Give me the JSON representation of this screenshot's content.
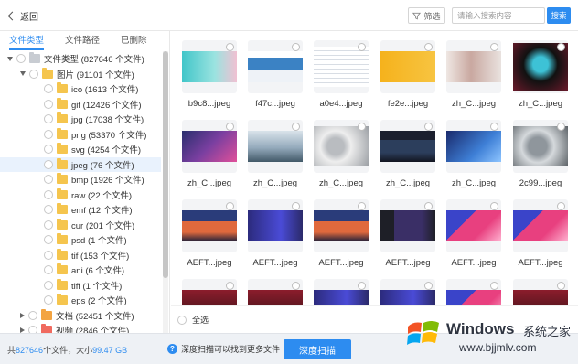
{
  "header": {
    "back_label": "返回",
    "filter_label": "筛选",
    "search_placeholder": "请输入搜索内容",
    "search_button": "搜索"
  },
  "sidebar": {
    "tabs": [
      {
        "label": "文件类型",
        "active": true
      },
      {
        "label": "文件路径",
        "active": false
      },
      {
        "label": "已删除",
        "active": false
      }
    ],
    "tree": [
      {
        "label": "文件类型 (827646 个文件)",
        "level": 0,
        "toggle": "down",
        "icon": "folder-gray"
      },
      {
        "label": "图片 (91101 个文件)",
        "level": 1,
        "toggle": "down",
        "icon": "folder-yellow"
      },
      {
        "label": "ico (1613 个文件)",
        "level": 2,
        "toggle": "",
        "icon": "folder-yellow"
      },
      {
        "label": "gif (12426 个文件)",
        "level": 2,
        "toggle": "",
        "icon": "folder-yellow"
      },
      {
        "label": "jpg (17038 个文件)",
        "level": 2,
        "toggle": "",
        "icon": "folder-yellow"
      },
      {
        "label": "png (53370 个文件)",
        "level": 2,
        "toggle": "",
        "icon": "folder-yellow"
      },
      {
        "label": "svg (4254 个文件)",
        "level": 2,
        "toggle": "",
        "icon": "folder-yellow"
      },
      {
        "label": "jpeg (76 个文件)",
        "level": 2,
        "toggle": "",
        "icon": "folder-yellow",
        "selected": true
      },
      {
        "label": "bmp (1926 个文件)",
        "level": 2,
        "toggle": "",
        "icon": "folder-yellow"
      },
      {
        "label": "raw (22 个文件)",
        "level": 2,
        "toggle": "",
        "icon": "folder-yellow"
      },
      {
        "label": "emf (12 个文件)",
        "level": 2,
        "toggle": "",
        "icon": "folder-yellow"
      },
      {
        "label": "cur (201 个文件)",
        "level": 2,
        "toggle": "",
        "icon": "folder-yellow"
      },
      {
        "label": "psd (1 个文件)",
        "level": 2,
        "toggle": "",
        "icon": "folder-yellow"
      },
      {
        "label": "tif (153 个文件)",
        "level": 2,
        "toggle": "",
        "icon": "folder-yellow"
      },
      {
        "label": "ani (6 个文件)",
        "level": 2,
        "toggle": "",
        "icon": "folder-yellow"
      },
      {
        "label": "tiff (1 个文件)",
        "level": 2,
        "toggle": "",
        "icon": "folder-yellow"
      },
      {
        "label": "eps (2 个文件)",
        "level": 2,
        "toggle": "",
        "icon": "folder-yellow"
      },
      {
        "label": "文档 (52451 个文件)",
        "level": 1,
        "toggle": "right",
        "icon": "folder-orange"
      },
      {
        "label": "视频 (2846 个文件)",
        "level": 1,
        "toggle": "right",
        "icon": "folder-red"
      }
    ]
  },
  "grid": {
    "rows": [
      [
        {
          "name": "b9c8...jpeg",
          "thumb": "banner-cyan"
        },
        {
          "name": "f47c...jpeg",
          "thumb": "web-page"
        },
        {
          "name": "a0e4...jpeg",
          "thumb": "document"
        },
        {
          "name": "fe2e...jpeg",
          "thumb": "yellow-banner"
        },
        {
          "name": "zh_C...jpeg",
          "thumb": "people-light"
        },
        {
          "name": "zh_C...jpeg",
          "thumb": "abstract-face"
        }
      ],
      [
        {
          "name": "zh_C...jpeg",
          "thumb": "purple-scene"
        },
        {
          "name": "zh_C...jpeg",
          "thumb": "jet-sky"
        },
        {
          "name": "zh_C...jpeg",
          "thumb": "gears-gray"
        },
        {
          "name": "zh_C...jpeg",
          "thumb": "dark-web"
        },
        {
          "name": "zh_C...jpeg",
          "thumb": "blue-gradient"
        },
        {
          "name": "2c99...jpeg",
          "thumb": "hard-drive"
        }
      ],
      [
        {
          "name": "AEFT...jpeg",
          "thumb": "sunset-screen"
        },
        {
          "name": "AEFT...jpeg",
          "thumb": "purple-ui"
        },
        {
          "name": "AEFT...jpeg",
          "thumb": "sunset-screen"
        },
        {
          "name": "AEFT...jpeg",
          "thumb": "dark-editor"
        },
        {
          "name": "AEFT...jpeg",
          "thumb": "pink-blocks"
        },
        {
          "name": "AEFT...jpeg",
          "thumb": "pink-blocks"
        }
      ],
      [
        {
          "name": "",
          "thumb": "dark-red"
        },
        {
          "name": "",
          "thumb": "dark-red"
        },
        {
          "name": "",
          "thumb": "purple-ui"
        },
        {
          "name": "",
          "thumb": "purple-ui"
        },
        {
          "name": "",
          "thumb": "pink-blocks"
        },
        {
          "name": "",
          "thumb": "dark-red"
        }
      ]
    ],
    "select_all_label": "全选"
  },
  "footer": {
    "count_prefix": "共",
    "count_value": "827646",
    "count_mid": "个文件，大小",
    "size_value": "99.47 GB",
    "hint": "深度扫描可以找到更多文件",
    "hint_icon": "question-icon",
    "deep_scan_button": "深度扫描"
  },
  "watermark": {
    "brand": "Windows",
    "suffix": "系统之家",
    "url": "www.bjjmlv.com"
  },
  "colors": {
    "accent": "#2d8cf0",
    "folder": "#f5c54e",
    "footer_bg": "#eef1f5"
  }
}
